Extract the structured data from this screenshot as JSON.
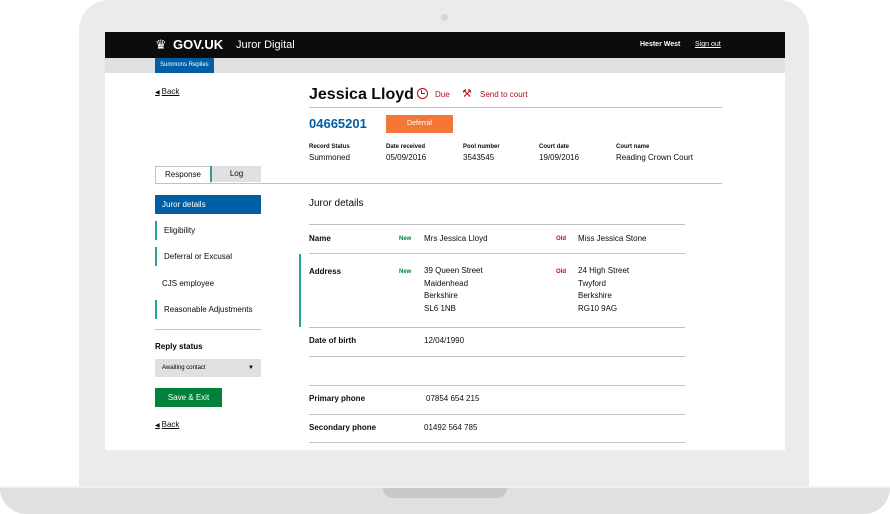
{
  "header": {
    "crown_glyph": "♛",
    "logo": "GOV.UK",
    "service": "Juror Digital",
    "user": "Hester West",
    "signout": "Sign out"
  },
  "subnav": {
    "tag": "Summons Replies"
  },
  "back_label": "Back",
  "juror": {
    "name": "Jessica Lloyd",
    "due": "Due",
    "send_to_court": "Send to court",
    "number": "04665201",
    "badge": "Deferral"
  },
  "meta": [
    {
      "label": "Record Status",
      "value": "Summoned"
    },
    {
      "label": "Date received",
      "value": "05/09/2016"
    },
    {
      "label": "Pool number",
      "value": "3543545"
    },
    {
      "label": "Court date",
      "value": "19/09/2016"
    },
    {
      "label": "Court name",
      "value": "Reading Crown Court"
    }
  ],
  "tabs": [
    "Response",
    "Log"
  ],
  "sidenav": [
    "Juror details",
    "Eligibility",
    "Deferral or Excusal",
    "CJS employee",
    "Reasonable Adjustments"
  ],
  "reply_status": {
    "label": "Reply status",
    "selected": "Awaiting contact",
    "save": "Save & Exit"
  },
  "details": {
    "title": "Juror details",
    "new_tag": "New",
    "old_tag": "Old",
    "name": {
      "label": "Name",
      "new": "Mrs Jessica Lloyd",
      "old": "Miss Jessica Stone"
    },
    "address": {
      "label": "Address",
      "new": [
        "39 Queen Street",
        "Maidenhead",
        "Berkshire",
        "SL6 1NB"
      ],
      "old": [
        "24 High Street",
        "Twyford",
        "Berkshire",
        "RG10 9AG"
      ]
    },
    "dob": {
      "label": "Date of birth",
      "value": "12/04/1990"
    },
    "primary_phone": {
      "label": "Primary phone",
      "value": "07854 654 215"
    },
    "secondary_phone": {
      "label": "Secondary phone",
      "value": "01492 564 785"
    }
  },
  "colors": {
    "brand": "#005ea5",
    "deferral": "#f47738",
    "save": "#00823b",
    "alert": "#b10e1e",
    "nav_marker": "#28a197"
  }
}
